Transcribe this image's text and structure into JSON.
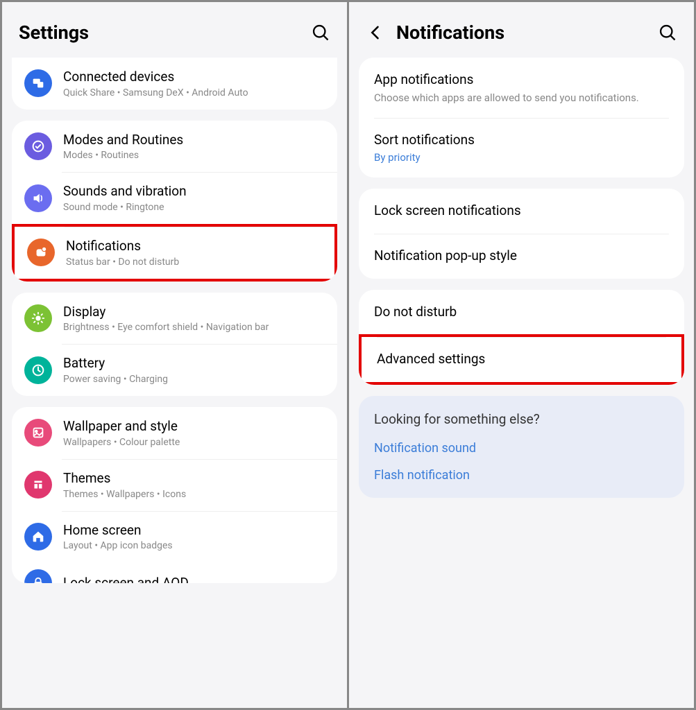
{
  "left": {
    "title": "Settings",
    "items": [
      {
        "title": "Connected devices",
        "sub": "Quick Share  •  Samsung DeX  •  Android Auto",
        "icon": "connected",
        "color": "#2e6be6"
      },
      {
        "title": "Modes and Routines",
        "sub": "Modes  •  Routines",
        "icon": "modes",
        "color": "#6b5ce0"
      },
      {
        "title": "Sounds and vibration",
        "sub": "Sound mode  •  Ringtone",
        "icon": "sound",
        "color": "#6b6df0"
      },
      {
        "title": "Notifications",
        "sub": "Status bar  •  Do not disturb",
        "icon": "notifications",
        "color": "#e8662b",
        "highlight": true
      },
      {
        "title": "Display",
        "sub": "Brightness  •  Eye comfort shield  •  Navigation bar",
        "icon": "display",
        "color": "#7cc234"
      },
      {
        "title": "Battery",
        "sub": "Power saving  •  Charging",
        "icon": "battery",
        "color": "#00b39a"
      },
      {
        "title": "Wallpaper and style",
        "sub": "Wallpapers  •  Colour palette",
        "icon": "wallpaper",
        "color": "#e84a7a"
      },
      {
        "title": "Themes",
        "sub": "Themes  •  Wallpapers  •  Icons",
        "icon": "themes",
        "color": "#e0376e"
      },
      {
        "title": "Home screen",
        "sub": "Layout  •  App icon badges",
        "icon": "home",
        "color": "#2e6be6"
      },
      {
        "title": "Lock screen and AOD",
        "sub": "",
        "icon": "lock",
        "color": "#2e6be6"
      }
    ]
  },
  "right": {
    "title": "Notifications",
    "items": [
      {
        "title": "App notifications",
        "desc": "Choose which apps are allowed to send you notifications."
      },
      {
        "title": "Sort notifications",
        "link": "By priority"
      },
      {
        "title": "Lock screen notifications"
      },
      {
        "title": "Notification pop-up style"
      },
      {
        "title": "Do not disturb"
      },
      {
        "title": "Advanced settings",
        "highlight": true
      }
    ],
    "extra": {
      "title": "Looking for something else?",
      "links": [
        "Notification sound",
        "Flash notification"
      ]
    }
  }
}
